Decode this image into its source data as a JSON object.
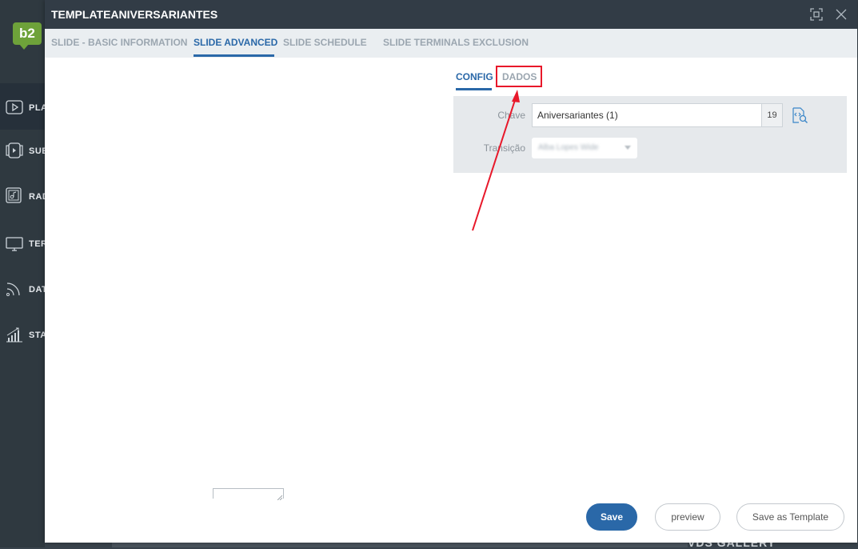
{
  "app": {
    "logo_text": "b2",
    "sidebar_items": [
      {
        "label": "PLAYLISTS",
        "icon": "play-icon"
      },
      {
        "label": "SUBSCRIPTIONS",
        "icon": "media-icon"
      },
      {
        "label": "RADIO",
        "icon": "music-icon"
      },
      {
        "label": "TERMINALS",
        "icon": "monitor-icon"
      },
      {
        "label": "DATA SOURCES",
        "icon": "feed-icon"
      },
      {
        "label": "STATISTICS",
        "icon": "chart-icon"
      }
    ],
    "background_text": "VDS GALLERY"
  },
  "modal": {
    "title": "TEMPLATEANIVERSARIANTES",
    "tabs": [
      {
        "label": "SLIDE - BASIC INFORMATION",
        "active": false
      },
      {
        "label": "SLIDE ADVANCED",
        "active": true
      },
      {
        "label": "SLIDE SCHEDULE",
        "active": false
      },
      {
        "label": "SLIDE TERMINALS EXCLUSION",
        "active": false
      }
    ],
    "subtabs": [
      {
        "label": "CONFIG",
        "active": true
      },
      {
        "label": "DADOS",
        "active": false
      }
    ],
    "config": {
      "chave_label": "Chave",
      "chave_value": "Aniversariantes (1)",
      "chave_count": "19",
      "transicao_label": "Transição",
      "transicao_value": "Alba Lopes Wide"
    },
    "buttons": {
      "save": "Save",
      "preview": "preview",
      "save_as_template": "Save as Template"
    }
  },
  "colors": {
    "accent": "#2a68a8",
    "header": "#323c46",
    "highlight": "#e8182a",
    "logo": "#6ea23a"
  }
}
